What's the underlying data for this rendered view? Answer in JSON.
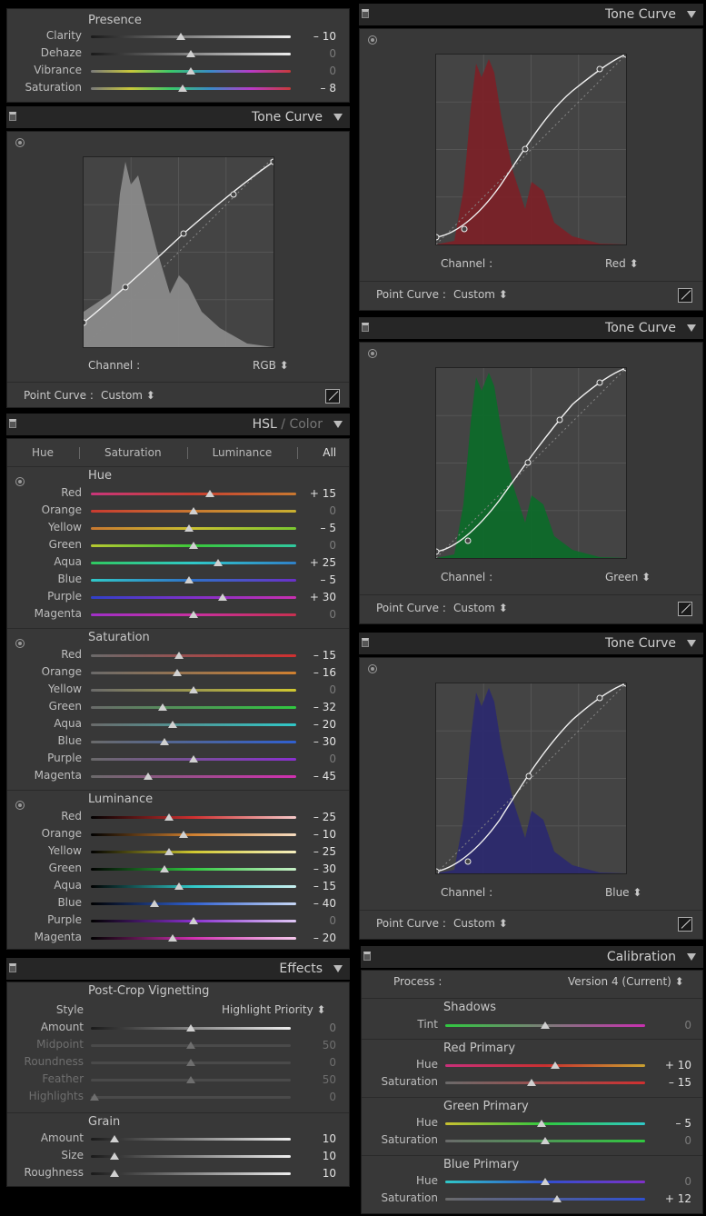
{
  "presence": {
    "title": "Presence",
    "sliders": [
      {
        "label": "Clarity",
        "value": "– 10",
        "pos": 0.45,
        "track": "gray"
      },
      {
        "label": "Dehaze",
        "value": "0",
        "pos": 0.5,
        "track": "gray"
      },
      {
        "label": "Vibrance",
        "value": "0",
        "pos": 0.5,
        "track": "rainbow"
      },
      {
        "label": "Saturation",
        "value": "– 8",
        "pos": 0.46,
        "track": "rainbow"
      }
    ]
  },
  "tone_rgb": {
    "title": "Tone Curve",
    "channel_label": "Channel :",
    "channel": "RGB ⬍",
    "point_curve_label": "Point Curve :",
    "point_curve": "Custom ⬍"
  },
  "tone_red": {
    "title": "Tone Curve",
    "channel_label": "Channel :",
    "channel": "Red ⬍",
    "point_curve_label": "Point Curve :",
    "point_curve": "Custom ⬍"
  },
  "tone_green": {
    "title": "Tone Curve",
    "channel_label": "Channel :",
    "channel": "Green ⬍",
    "point_curve_label": "Point Curve :",
    "point_curve": "Custom ⬍"
  },
  "tone_blue": {
    "title": "Tone Curve",
    "channel_label": "Channel :",
    "channel": "Blue ⬍",
    "point_curve_label": "Point Curve :",
    "point_curve": "Custom ⬍"
  },
  "hsl": {
    "title_a": "HSL",
    "title_b": " / Color",
    "tabs": [
      "Hue",
      "Saturation",
      "Luminance",
      "All"
    ],
    "hue_title": "Hue",
    "saturation_title": "Saturation",
    "luminance_title": "Luminance",
    "hue": [
      {
        "label": "Red",
        "value": "+ 15",
        "pos": 0.58
      },
      {
        "label": "Orange",
        "value": "0",
        "pos": 0.5
      },
      {
        "label": "Yellow",
        "value": "– 5",
        "pos": 0.48
      },
      {
        "label": "Green",
        "value": "0",
        "pos": 0.5
      },
      {
        "label": "Aqua",
        "value": "+ 25",
        "pos": 0.62
      },
      {
        "label": "Blue",
        "value": "– 5",
        "pos": 0.48
      },
      {
        "label": "Purple",
        "value": "+ 30",
        "pos": 0.64
      },
      {
        "label": "Magenta",
        "value": "0",
        "pos": 0.5
      }
    ],
    "saturation": [
      {
        "label": "Red",
        "value": "– 15",
        "pos": 0.43
      },
      {
        "label": "Orange",
        "value": "– 16",
        "pos": 0.42
      },
      {
        "label": "Yellow",
        "value": "0",
        "pos": 0.5
      },
      {
        "label": "Green",
        "value": "– 32",
        "pos": 0.35
      },
      {
        "label": "Aqua",
        "value": "– 20",
        "pos": 0.4
      },
      {
        "label": "Blue",
        "value": "– 30",
        "pos": 0.36
      },
      {
        "label": "Purple",
        "value": "0",
        "pos": 0.5
      },
      {
        "label": "Magenta",
        "value": "– 45",
        "pos": 0.28
      }
    ],
    "luminance": [
      {
        "label": "Red",
        "value": "– 25",
        "pos": 0.38
      },
      {
        "label": "Orange",
        "value": "– 10",
        "pos": 0.45
      },
      {
        "label": "Yellow",
        "value": "– 25",
        "pos": 0.38
      },
      {
        "label": "Green",
        "value": "– 30",
        "pos": 0.36
      },
      {
        "label": "Aqua",
        "value": "– 15",
        "pos": 0.43
      },
      {
        "label": "Blue",
        "value": "– 40",
        "pos": 0.31
      },
      {
        "label": "Purple",
        "value": "0",
        "pos": 0.5
      },
      {
        "label": "Magenta",
        "value": "– 20",
        "pos": 0.4
      }
    ]
  },
  "effects": {
    "title": "Effects",
    "vignette_title": "Post-Crop Vignetting",
    "style_label": "Style",
    "style_value": "Highlight Priority ⬍",
    "vignette": [
      {
        "label": "Amount",
        "value": "0",
        "pos": 0.5
      },
      {
        "label": "Midpoint",
        "value": "50",
        "pos": 0.5
      },
      {
        "label": "Roundness",
        "value": "0",
        "pos": 0.5
      },
      {
        "label": "Feather",
        "value": "50",
        "pos": 0.5
      },
      {
        "label": "Highlights",
        "value": "0",
        "pos": 0.02
      }
    ],
    "grain_title": "Grain",
    "grain": [
      {
        "label": "Amount",
        "value": "10",
        "pos": 0.12
      },
      {
        "label": "Size",
        "value": "10",
        "pos": 0.12
      },
      {
        "label": "Roughness",
        "value": "10",
        "pos": 0.12
      }
    ]
  },
  "calibration": {
    "title": "Calibration",
    "process_label": "Process :",
    "process_value": "Version 4 (Current) ⬍",
    "shadows_title": "Shadows",
    "shadows": [
      {
        "label": "Tint",
        "value": "0",
        "pos": 0.5
      }
    ],
    "red_title": "Red Primary",
    "red": [
      {
        "label": "Hue",
        "value": "+ 10",
        "pos": 0.55
      },
      {
        "label": "Saturation",
        "value": "– 15",
        "pos": 0.43
      }
    ],
    "green_title": "Green Primary",
    "green": [
      {
        "label": "Hue",
        "value": "– 5",
        "pos": 0.48
      },
      {
        "label": "Saturation",
        "value": "0",
        "pos": 0.5
      }
    ],
    "blue_title": "Blue Primary",
    "blue": [
      {
        "label": "Hue",
        "value": "0",
        "pos": 0.5
      },
      {
        "label": "Saturation",
        "value": "+ 12",
        "pos": 0.56
      }
    ]
  },
  "colors": {
    "bg": "#383838",
    "header": "#262626",
    "graph": "#444444",
    "hist_gray": "#8a8a8a",
    "hist_red": "#7a2228",
    "hist_green": "#0e6a2a",
    "hist_blue": "#2c2a6e"
  }
}
